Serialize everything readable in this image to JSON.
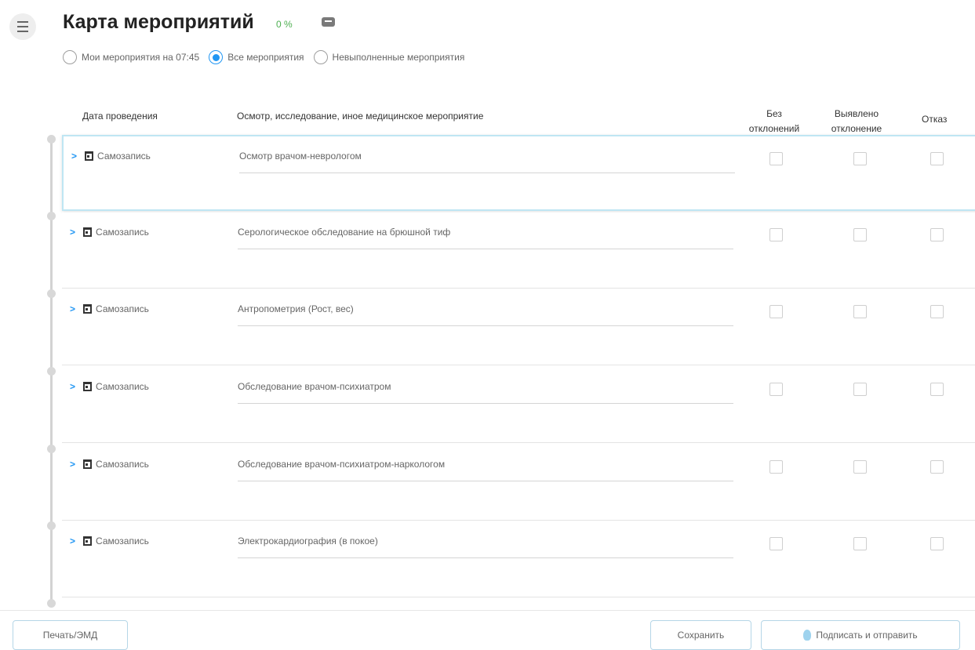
{
  "header": {
    "title": "Карта мероприятий",
    "progress": "0 %"
  },
  "filters": [
    {
      "label": "Мои мероприятия на 07:45",
      "checked": false
    },
    {
      "label": "Все мероприятия",
      "checked": true
    },
    {
      "label": "Невыполненные мероприятия",
      "checked": false
    }
  ],
  "table": {
    "columns": {
      "date": "Дата проведения",
      "event": "Осмотр, исследование, иное медицинское мероприятие",
      "no_deviation": [
        "Без",
        "отклонений"
      ],
      "deviation_found": [
        "Выявлено",
        "отклонение"
      ],
      "refusal": "Отказ"
    },
    "rows": [
      {
        "date": "Самозапись",
        "event": "Осмотр врачом-неврологом"
      },
      {
        "date": "Самозапись",
        "event": "Серологическое обследование на брюшной тиф"
      },
      {
        "date": "Самозапись",
        "event": "Антропометрия (Рост, вес)"
      },
      {
        "date": "Самозапись",
        "event": "Обследование врачом-психиатром"
      },
      {
        "date": "Самозапись",
        "event": "Обследование врачом-психиатром-наркологом"
      },
      {
        "date": "Самозапись",
        "event": "Электрокардиография (в покое)"
      }
    ]
  },
  "footer": {
    "print": "Печать/ЭМД",
    "save": "Сохранить",
    "sign": "Подписать и отправить"
  },
  "colors": {
    "accent": "#2196f3",
    "progress": "#4caf50",
    "button_border": "#b5d6e7"
  }
}
